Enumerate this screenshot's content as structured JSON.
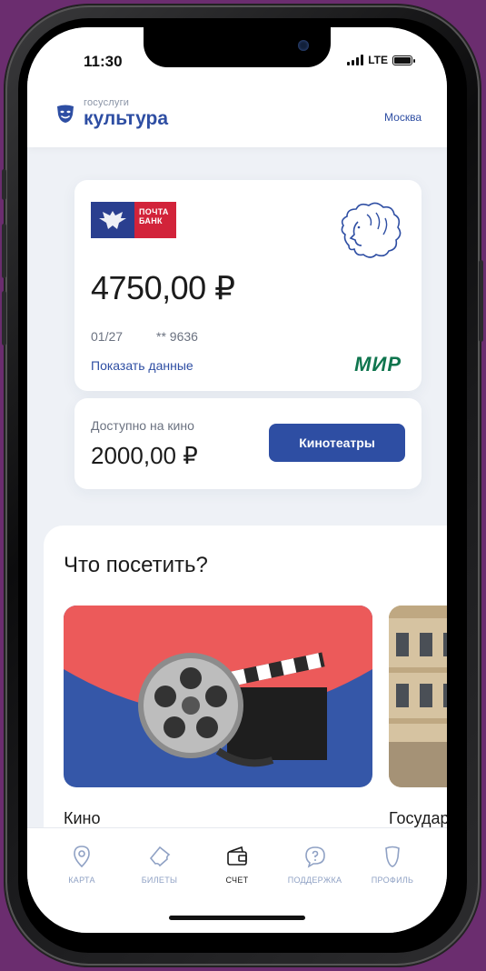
{
  "status": {
    "time": "11:30",
    "network": "LTE"
  },
  "header": {
    "brand_small": "госуслуги",
    "brand_big": "культура",
    "city": "Москва"
  },
  "card": {
    "bank_name": "ПОЧТА БАНК",
    "balance": "4750,00 ₽",
    "expiry": "01/27",
    "number": "** 9636",
    "show_data": "Показать данные",
    "payment_system": "МИР"
  },
  "cinema": {
    "label": "Доступно на кино",
    "amount": "2000,00 ₽",
    "button": "Кинотеатры"
  },
  "visit": {
    "title": "Что посетить?",
    "tiles": [
      {
        "label": "Кино"
      },
      {
        "label": "Государ"
      }
    ]
  },
  "tabbar": {
    "items": [
      {
        "label": "КАРТА",
        "icon": "map-pin-icon"
      },
      {
        "label": "БИЛЕТЫ",
        "icon": "ticket-icon"
      },
      {
        "label": "СЧЕТ",
        "icon": "wallet-icon"
      },
      {
        "label": "ПОДДЕРЖКА",
        "icon": "support-icon"
      },
      {
        "label": "ПРОФИЛЬ",
        "icon": "profile-icon"
      }
    ],
    "active_index": 2
  },
  "colors": {
    "accent": "#2e4ea3",
    "mir": "#0f754e",
    "bank_red": "#d2233a",
    "bg": "#6b2d6f"
  }
}
